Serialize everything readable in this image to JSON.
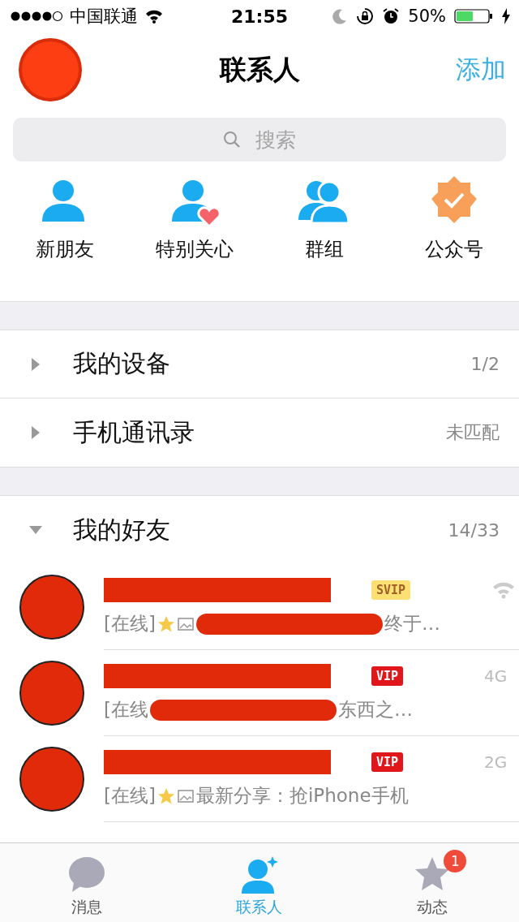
{
  "status_bar": {
    "carrier": "中国联通",
    "time": "21:55",
    "battery": "50%"
  },
  "header": {
    "title": "联系人",
    "action": "添加"
  },
  "search": {
    "placeholder": "搜索"
  },
  "shortcuts": [
    {
      "label": "新朋友",
      "kind": "person"
    },
    {
      "label": "特别关心",
      "kind": "heart"
    },
    {
      "label": "群组",
      "kind": "group"
    },
    {
      "label": "公众号",
      "kind": "official"
    }
  ],
  "groups": [
    {
      "name": "我的设备",
      "count": "1/2",
      "expanded": false
    },
    {
      "name": "手机通讯录",
      "count": "未匹配",
      "expanded": false
    }
  ],
  "friend_group": {
    "name": "我的好友",
    "count": "14/33",
    "expanded": true
  },
  "friends": [
    {
      "badge": {
        "text": "SVIP",
        "kind": "gold"
      },
      "network": {
        "kind": "wifi"
      },
      "message": {
        "prefix": "[在线]",
        "star": true,
        "image_icon": true,
        "redacted": true,
        "text": "终于…"
      }
    },
    {
      "badge": {
        "text": "VIP",
        "kind": "red"
      },
      "network": {
        "kind": "text",
        "text": "4G"
      },
      "message": {
        "prefix": "[在线",
        "star": false,
        "image_icon": false,
        "redacted": true,
        "text": "东西之…"
      }
    },
    {
      "badge": {
        "text": "VIP",
        "kind": "red"
      },
      "network": {
        "kind": "text",
        "text": "2G"
      },
      "message": {
        "prefix": "[在线]",
        "star": true,
        "image_icon": true,
        "redacted": false,
        "text": "最新分享：抢iPhone手机"
      }
    }
  ],
  "tabs": [
    {
      "label": "消息",
      "kind": "chat",
      "selected": false
    },
    {
      "label": "联系人",
      "kind": "contacts",
      "selected": true
    },
    {
      "label": "动态",
      "kind": "star",
      "selected": false,
      "badge": "1"
    }
  ]
}
